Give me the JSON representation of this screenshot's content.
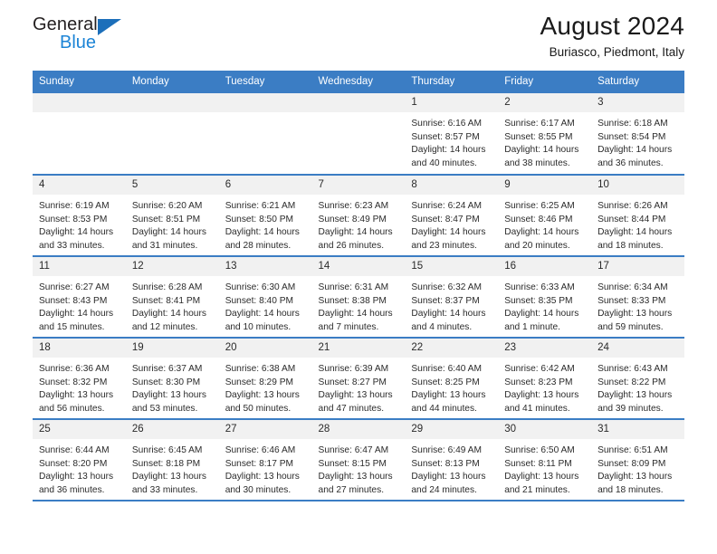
{
  "brand": {
    "name_dark": "General",
    "name_blue": "Blue",
    "accent_blue": "#1c84d6",
    "triangle_blue": "#1c6fba"
  },
  "header": {
    "title": "August 2024",
    "location": "Buriasco, Piedmont, Italy",
    "header_bg": "#3b7dc4"
  },
  "weekday_headers": [
    "Sunday",
    "Monday",
    "Tuesday",
    "Wednesday",
    "Thursday",
    "Friday",
    "Saturday"
  ],
  "weeks": [
    [
      {
        "day": "",
        "empty": true
      },
      {
        "day": "",
        "empty": true
      },
      {
        "day": "",
        "empty": true
      },
      {
        "day": "",
        "empty": true
      },
      {
        "day": "1",
        "sunrise": "Sunrise: 6:16 AM",
        "sunset": "Sunset: 8:57 PM",
        "daylight": "Daylight: 14 hours and 40 minutes."
      },
      {
        "day": "2",
        "sunrise": "Sunrise: 6:17 AM",
        "sunset": "Sunset: 8:55 PM",
        "daylight": "Daylight: 14 hours and 38 minutes."
      },
      {
        "day": "3",
        "sunrise": "Sunrise: 6:18 AM",
        "sunset": "Sunset: 8:54 PM",
        "daylight": "Daylight: 14 hours and 36 minutes."
      }
    ],
    [
      {
        "day": "4",
        "sunrise": "Sunrise: 6:19 AM",
        "sunset": "Sunset: 8:53 PM",
        "daylight": "Daylight: 14 hours and 33 minutes."
      },
      {
        "day": "5",
        "sunrise": "Sunrise: 6:20 AM",
        "sunset": "Sunset: 8:51 PM",
        "daylight": "Daylight: 14 hours and 31 minutes."
      },
      {
        "day": "6",
        "sunrise": "Sunrise: 6:21 AM",
        "sunset": "Sunset: 8:50 PM",
        "daylight": "Daylight: 14 hours and 28 minutes."
      },
      {
        "day": "7",
        "sunrise": "Sunrise: 6:23 AM",
        "sunset": "Sunset: 8:49 PM",
        "daylight": "Daylight: 14 hours and 26 minutes."
      },
      {
        "day": "8",
        "sunrise": "Sunrise: 6:24 AM",
        "sunset": "Sunset: 8:47 PM",
        "daylight": "Daylight: 14 hours and 23 minutes."
      },
      {
        "day": "9",
        "sunrise": "Sunrise: 6:25 AM",
        "sunset": "Sunset: 8:46 PM",
        "daylight": "Daylight: 14 hours and 20 minutes."
      },
      {
        "day": "10",
        "sunrise": "Sunrise: 6:26 AM",
        "sunset": "Sunset: 8:44 PM",
        "daylight": "Daylight: 14 hours and 18 minutes."
      }
    ],
    [
      {
        "day": "11",
        "sunrise": "Sunrise: 6:27 AM",
        "sunset": "Sunset: 8:43 PM",
        "daylight": "Daylight: 14 hours and 15 minutes."
      },
      {
        "day": "12",
        "sunrise": "Sunrise: 6:28 AM",
        "sunset": "Sunset: 8:41 PM",
        "daylight": "Daylight: 14 hours and 12 minutes."
      },
      {
        "day": "13",
        "sunrise": "Sunrise: 6:30 AM",
        "sunset": "Sunset: 8:40 PM",
        "daylight": "Daylight: 14 hours and 10 minutes."
      },
      {
        "day": "14",
        "sunrise": "Sunrise: 6:31 AM",
        "sunset": "Sunset: 8:38 PM",
        "daylight": "Daylight: 14 hours and 7 minutes."
      },
      {
        "day": "15",
        "sunrise": "Sunrise: 6:32 AM",
        "sunset": "Sunset: 8:37 PM",
        "daylight": "Daylight: 14 hours and 4 minutes."
      },
      {
        "day": "16",
        "sunrise": "Sunrise: 6:33 AM",
        "sunset": "Sunset: 8:35 PM",
        "daylight": "Daylight: 14 hours and 1 minute."
      },
      {
        "day": "17",
        "sunrise": "Sunrise: 6:34 AM",
        "sunset": "Sunset: 8:33 PM",
        "daylight": "Daylight: 13 hours and 59 minutes."
      }
    ],
    [
      {
        "day": "18",
        "sunrise": "Sunrise: 6:36 AM",
        "sunset": "Sunset: 8:32 PM",
        "daylight": "Daylight: 13 hours and 56 minutes."
      },
      {
        "day": "19",
        "sunrise": "Sunrise: 6:37 AM",
        "sunset": "Sunset: 8:30 PM",
        "daylight": "Daylight: 13 hours and 53 minutes."
      },
      {
        "day": "20",
        "sunrise": "Sunrise: 6:38 AM",
        "sunset": "Sunset: 8:29 PM",
        "daylight": "Daylight: 13 hours and 50 minutes."
      },
      {
        "day": "21",
        "sunrise": "Sunrise: 6:39 AM",
        "sunset": "Sunset: 8:27 PM",
        "daylight": "Daylight: 13 hours and 47 minutes."
      },
      {
        "day": "22",
        "sunrise": "Sunrise: 6:40 AM",
        "sunset": "Sunset: 8:25 PM",
        "daylight": "Daylight: 13 hours and 44 minutes."
      },
      {
        "day": "23",
        "sunrise": "Sunrise: 6:42 AM",
        "sunset": "Sunset: 8:23 PM",
        "daylight": "Daylight: 13 hours and 41 minutes."
      },
      {
        "day": "24",
        "sunrise": "Sunrise: 6:43 AM",
        "sunset": "Sunset: 8:22 PM",
        "daylight": "Daylight: 13 hours and 39 minutes."
      }
    ],
    [
      {
        "day": "25",
        "sunrise": "Sunrise: 6:44 AM",
        "sunset": "Sunset: 8:20 PM",
        "daylight": "Daylight: 13 hours and 36 minutes."
      },
      {
        "day": "26",
        "sunrise": "Sunrise: 6:45 AM",
        "sunset": "Sunset: 8:18 PM",
        "daylight": "Daylight: 13 hours and 33 minutes."
      },
      {
        "day": "27",
        "sunrise": "Sunrise: 6:46 AM",
        "sunset": "Sunset: 8:17 PM",
        "daylight": "Daylight: 13 hours and 30 minutes."
      },
      {
        "day": "28",
        "sunrise": "Sunrise: 6:47 AM",
        "sunset": "Sunset: 8:15 PM",
        "daylight": "Daylight: 13 hours and 27 minutes."
      },
      {
        "day": "29",
        "sunrise": "Sunrise: 6:49 AM",
        "sunset": "Sunset: 8:13 PM",
        "daylight": "Daylight: 13 hours and 24 minutes."
      },
      {
        "day": "30",
        "sunrise": "Sunrise: 6:50 AM",
        "sunset": "Sunset: 8:11 PM",
        "daylight": "Daylight: 13 hours and 21 minutes."
      },
      {
        "day": "31",
        "sunrise": "Sunrise: 6:51 AM",
        "sunset": "Sunset: 8:09 PM",
        "daylight": "Daylight: 13 hours and 18 minutes."
      }
    ]
  ]
}
